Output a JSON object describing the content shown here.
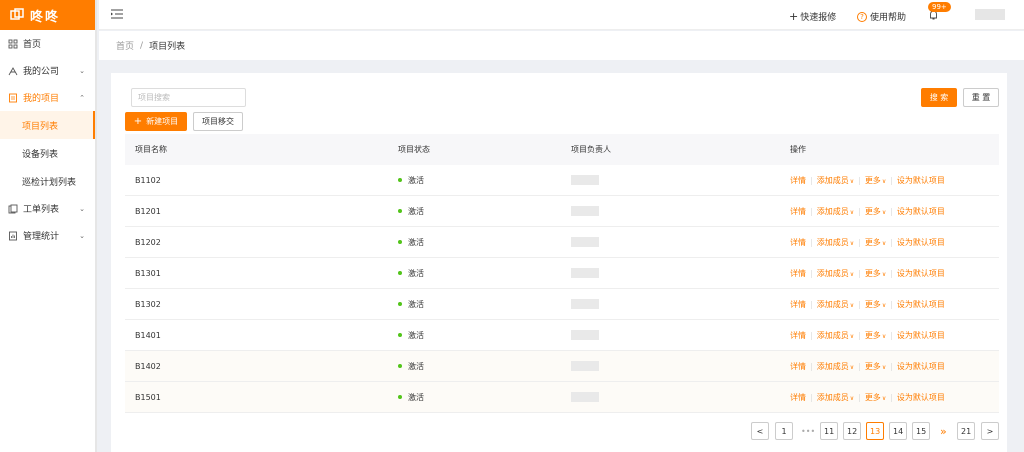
{
  "app": {
    "logo_text": "咚咚",
    "brand_color": "#ff7d00"
  },
  "sidebar": {
    "items": [
      {
        "label": "首页",
        "icon": "grid-icon"
      },
      {
        "label": "我的公司",
        "icon": "company-icon",
        "chevron": "down"
      },
      {
        "label": "我的项目",
        "icon": "project-icon",
        "chevron": "up",
        "active": true
      }
    ],
    "sub_items": [
      {
        "label": "项目列表",
        "active": true
      },
      {
        "label": "设备列表"
      },
      {
        "label": "巡检计划列表"
      }
    ],
    "items_after": [
      {
        "label": "工单列表",
        "icon": "ticket-icon",
        "chevron": "down"
      },
      {
        "label": "管理统计",
        "icon": "stats-icon",
        "chevron": "down"
      }
    ]
  },
  "topbar": {
    "quick_report": "快速报修",
    "help": "使用帮助",
    "notification_badge": "99+"
  },
  "breadcrumb": {
    "home": "首页",
    "separator": "/",
    "current": "项目列表"
  },
  "toolbar": {
    "search_placeholder": "项目搜索",
    "search_button": "搜 索",
    "reset_button": "重 置",
    "new_button": "新建项目",
    "transfer_button": "项目移交"
  },
  "table": {
    "columns": [
      "项目名称",
      "项目状态",
      "项目负责人",
      "操作"
    ],
    "status_color": "#52c41a",
    "rows": [
      {
        "name": "B1102",
        "status": "激活"
      },
      {
        "name": "B1201",
        "status": "激活"
      },
      {
        "name": "B1202",
        "status": "激活"
      },
      {
        "name": "B1301",
        "status": "激活"
      },
      {
        "name": "B1302",
        "status": "激活"
      },
      {
        "name": "B1401",
        "status": "激活"
      },
      {
        "name": "B1402",
        "status": "激活"
      },
      {
        "name": "B1501",
        "status": "激活"
      }
    ],
    "actions": {
      "detail": "详情",
      "add_member": "添加成员",
      "more": "更多",
      "set_default": "设为默认项目"
    }
  },
  "pagination": {
    "prev": "<",
    "first": "1",
    "ellipsis": "•••",
    "pages": [
      "11",
      "12",
      "13",
      "14",
      "15"
    ],
    "current": "13",
    "jump": "»",
    "last": "21",
    "next": ">"
  }
}
